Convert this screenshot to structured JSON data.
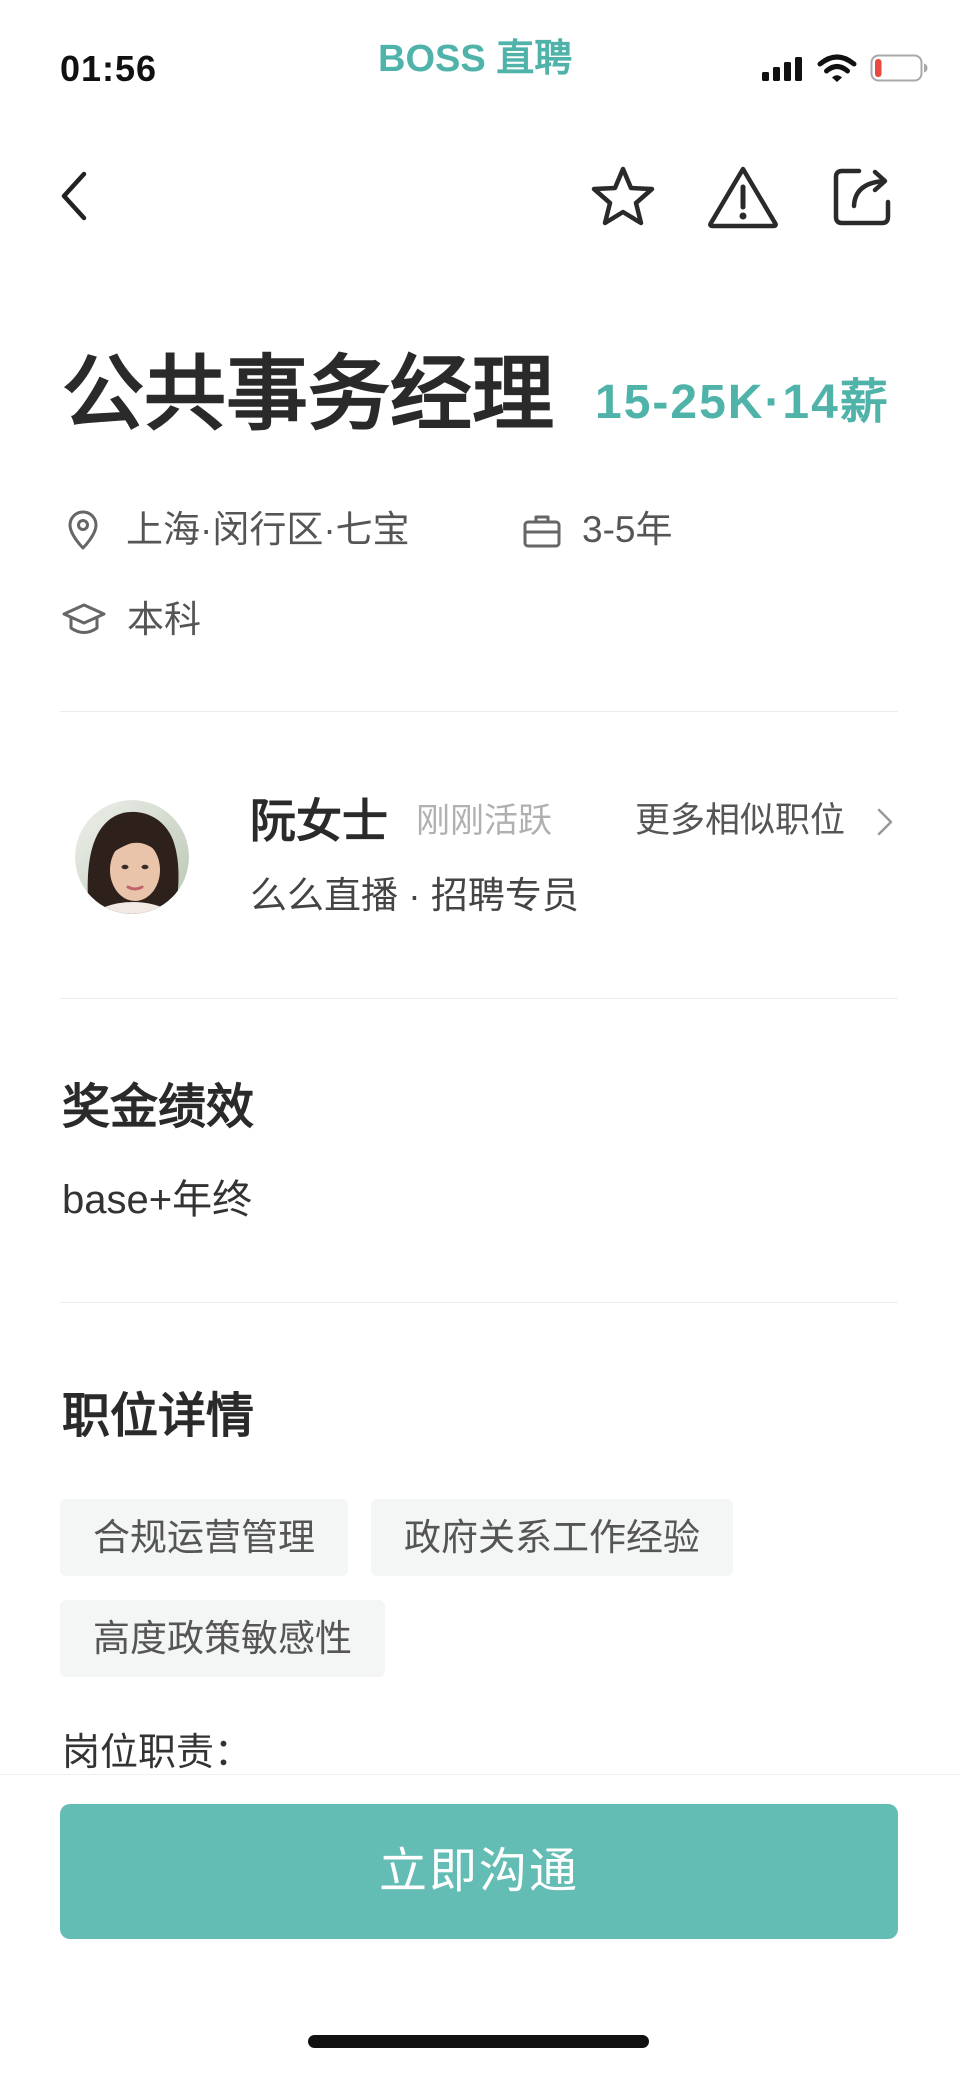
{
  "status_bar": {
    "time": "01:56",
    "brand": "BOSS 直聘",
    "signal_icon": "cellular-signal-icon",
    "wifi_icon": "wifi-icon",
    "battery_icon": "battery-icon",
    "battery_level_percent": 15
  },
  "nav": {
    "back_icon": "chevron-left-icon",
    "favorite_icon": "star-icon",
    "report_icon": "warning-icon",
    "share_icon": "share-icon"
  },
  "job": {
    "title": "公共事务经理",
    "salary": "15-25K·14薪",
    "location_icon": "location-pin-icon",
    "location": "上海·闵行区·七宝",
    "experience_icon": "briefcase-icon",
    "experience": "3-5年",
    "education_icon": "graduation-cap-icon",
    "education": "本科"
  },
  "recruiter": {
    "avatar": "recruiter-avatar-photo",
    "name": "阮女士",
    "activity_status": "刚刚活跃",
    "more_jobs_link": "更多相似职位",
    "more_jobs_icon": "chevron-right-icon",
    "company_and_role": "么么直播 · 招聘专员"
  },
  "bonus": {
    "heading": "奖金绩效",
    "content": "base+年终"
  },
  "details": {
    "heading": "职位详情",
    "tags": [
      "合规运营管理",
      "政府关系工作经验",
      "高度政策敏感性"
    ],
    "responsibilities_label": "岗位职责："
  },
  "footer": {
    "chat_button_label": "立即沟通"
  },
  "colors": {
    "accent": "#4fb3aa",
    "button": "#63bdb5",
    "battery_low": "#e84a3f",
    "text_primary": "#222222",
    "text_secondary": "#555555"
  }
}
